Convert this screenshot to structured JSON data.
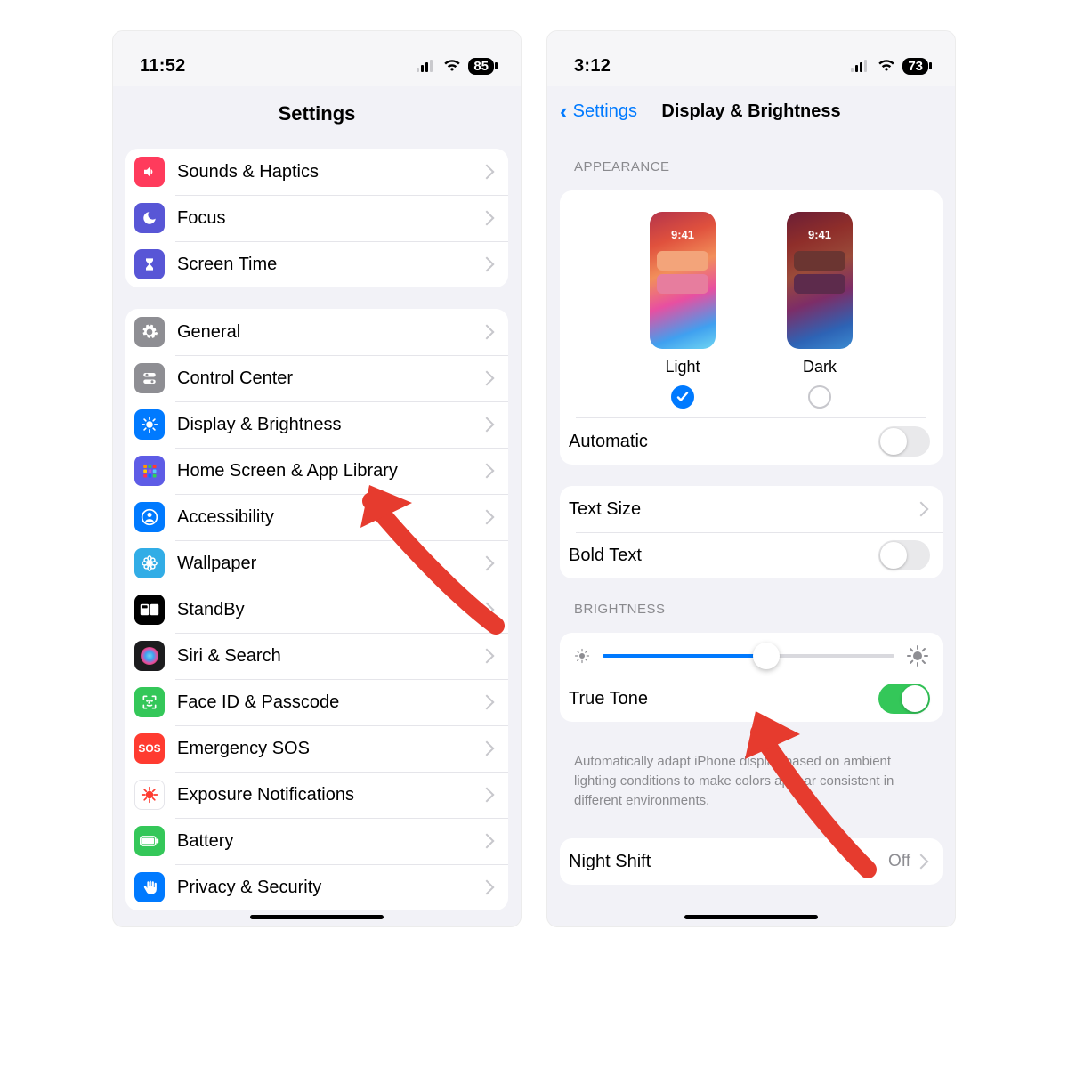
{
  "left": {
    "status_time": "11:52",
    "battery": "85",
    "nav_title": "Settings",
    "group1": [
      {
        "icon": "speaker",
        "color": "#ff3b5c",
        "label": "Sounds & Haptics"
      },
      {
        "icon": "moon",
        "color": "#5856d6",
        "label": "Focus"
      },
      {
        "icon": "hourglass",
        "color": "#5856d6",
        "label": "Screen Time"
      }
    ],
    "group2": [
      {
        "icon": "gear",
        "color": "#8e8e93",
        "label": "General"
      },
      {
        "icon": "toggles",
        "color": "#8e8e93",
        "label": "Control Center"
      },
      {
        "icon": "sun",
        "color": "#007aff",
        "label": "Display & Brightness"
      },
      {
        "icon": "grid",
        "color": "#5e5ce6",
        "label": "Home Screen & App Library"
      },
      {
        "icon": "person",
        "color": "#007aff",
        "label": "Accessibility"
      },
      {
        "icon": "flower",
        "color": "#32ade6",
        "label": "Wallpaper"
      },
      {
        "icon": "standby",
        "color": "#000000",
        "label": "StandBy"
      },
      {
        "icon": "siri",
        "color": "#1c1c1e",
        "label": "Siri & Search"
      },
      {
        "icon": "faceid",
        "color": "#34c759",
        "label": "Face ID & Passcode"
      },
      {
        "icon": "sos",
        "color": "#ff3b30",
        "label": "Emergency SOS",
        "text": "SOS"
      },
      {
        "icon": "virus",
        "color": "#ffffff",
        "label": "Exposure Notifications",
        "fg": "#ff3b30",
        "border": true
      },
      {
        "icon": "battery",
        "color": "#34c759",
        "label": "Battery"
      },
      {
        "icon": "hand",
        "color": "#007aff",
        "label": "Privacy & Security"
      }
    ]
  },
  "right": {
    "status_time": "3:12",
    "battery": "73",
    "back_label": "Settings",
    "nav_title": "Display & Brightness",
    "appearance_header": "APPEARANCE",
    "appearance": {
      "thumb_time": "9:41",
      "options": [
        {
          "label": "Light",
          "checked": true
        },
        {
          "label": "Dark",
          "checked": false
        }
      ],
      "automatic_label": "Automatic",
      "automatic_on": false
    },
    "text_group": {
      "text_size_label": "Text Size",
      "bold_label": "Bold Text",
      "bold_on": false
    },
    "brightness_header": "BRIGHTNESS",
    "brightness_percent": 56,
    "truetone_label": "True Tone",
    "truetone_on": true,
    "truetone_note": "Automatically adapt iPhone display based on ambient lighting conditions to make colors appear consistent in different environments.",
    "nightshift_label": "Night Shift",
    "nightshift_value": "Off"
  }
}
